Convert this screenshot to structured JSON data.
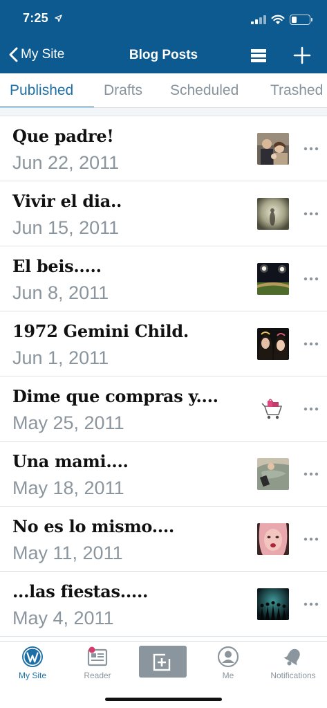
{
  "status_bar": {
    "time": "7:25",
    "battery_level": 0.3
  },
  "nav": {
    "back_label": "My Site",
    "title": "Blog Posts"
  },
  "tabs": [
    {
      "label": "Published",
      "active": true
    },
    {
      "label": "Drafts",
      "active": false
    },
    {
      "label": "Scheduled",
      "active": false
    },
    {
      "label": "Trashed",
      "active": false
    }
  ],
  "posts": [
    {
      "title": "Que padre!",
      "date": "Jun 22, 2011",
      "thumb": "family-photo"
    },
    {
      "title": "Vivir el dia..",
      "date": "Jun 15, 2011",
      "thumb": "misty-figure"
    },
    {
      "title": "El beis.....",
      "date": "Jun 8, 2011",
      "thumb": "baseball-field-night"
    },
    {
      "title": "1972 Gemini Child.",
      "date": "Jun 1, 2011",
      "thumb": "two-girls"
    },
    {
      "title": "Dime que compras y....",
      "date": "May 25, 2011",
      "thumb": "shopping-cart"
    },
    {
      "title": "Una mami....",
      "date": "May 18, 2011",
      "thumb": "baby-blanket"
    },
    {
      "title": "No es lo mismo....",
      "date": "May 11, 2011",
      "thumb": "woman-portrait"
    },
    {
      "title": "...las fiestas.....",
      "date": "May 4, 2011",
      "thumb": "party-crowd"
    }
  ],
  "bottom_tabs": {
    "my_site": "My Site",
    "reader": "Reader",
    "me": "Me",
    "notifications": "Notifications"
  },
  "colors": {
    "header_bg": "#0c5a8f",
    "accent": "#1d6fa6",
    "muted": "#8b959d",
    "reader_badge": "#d63b6b"
  }
}
